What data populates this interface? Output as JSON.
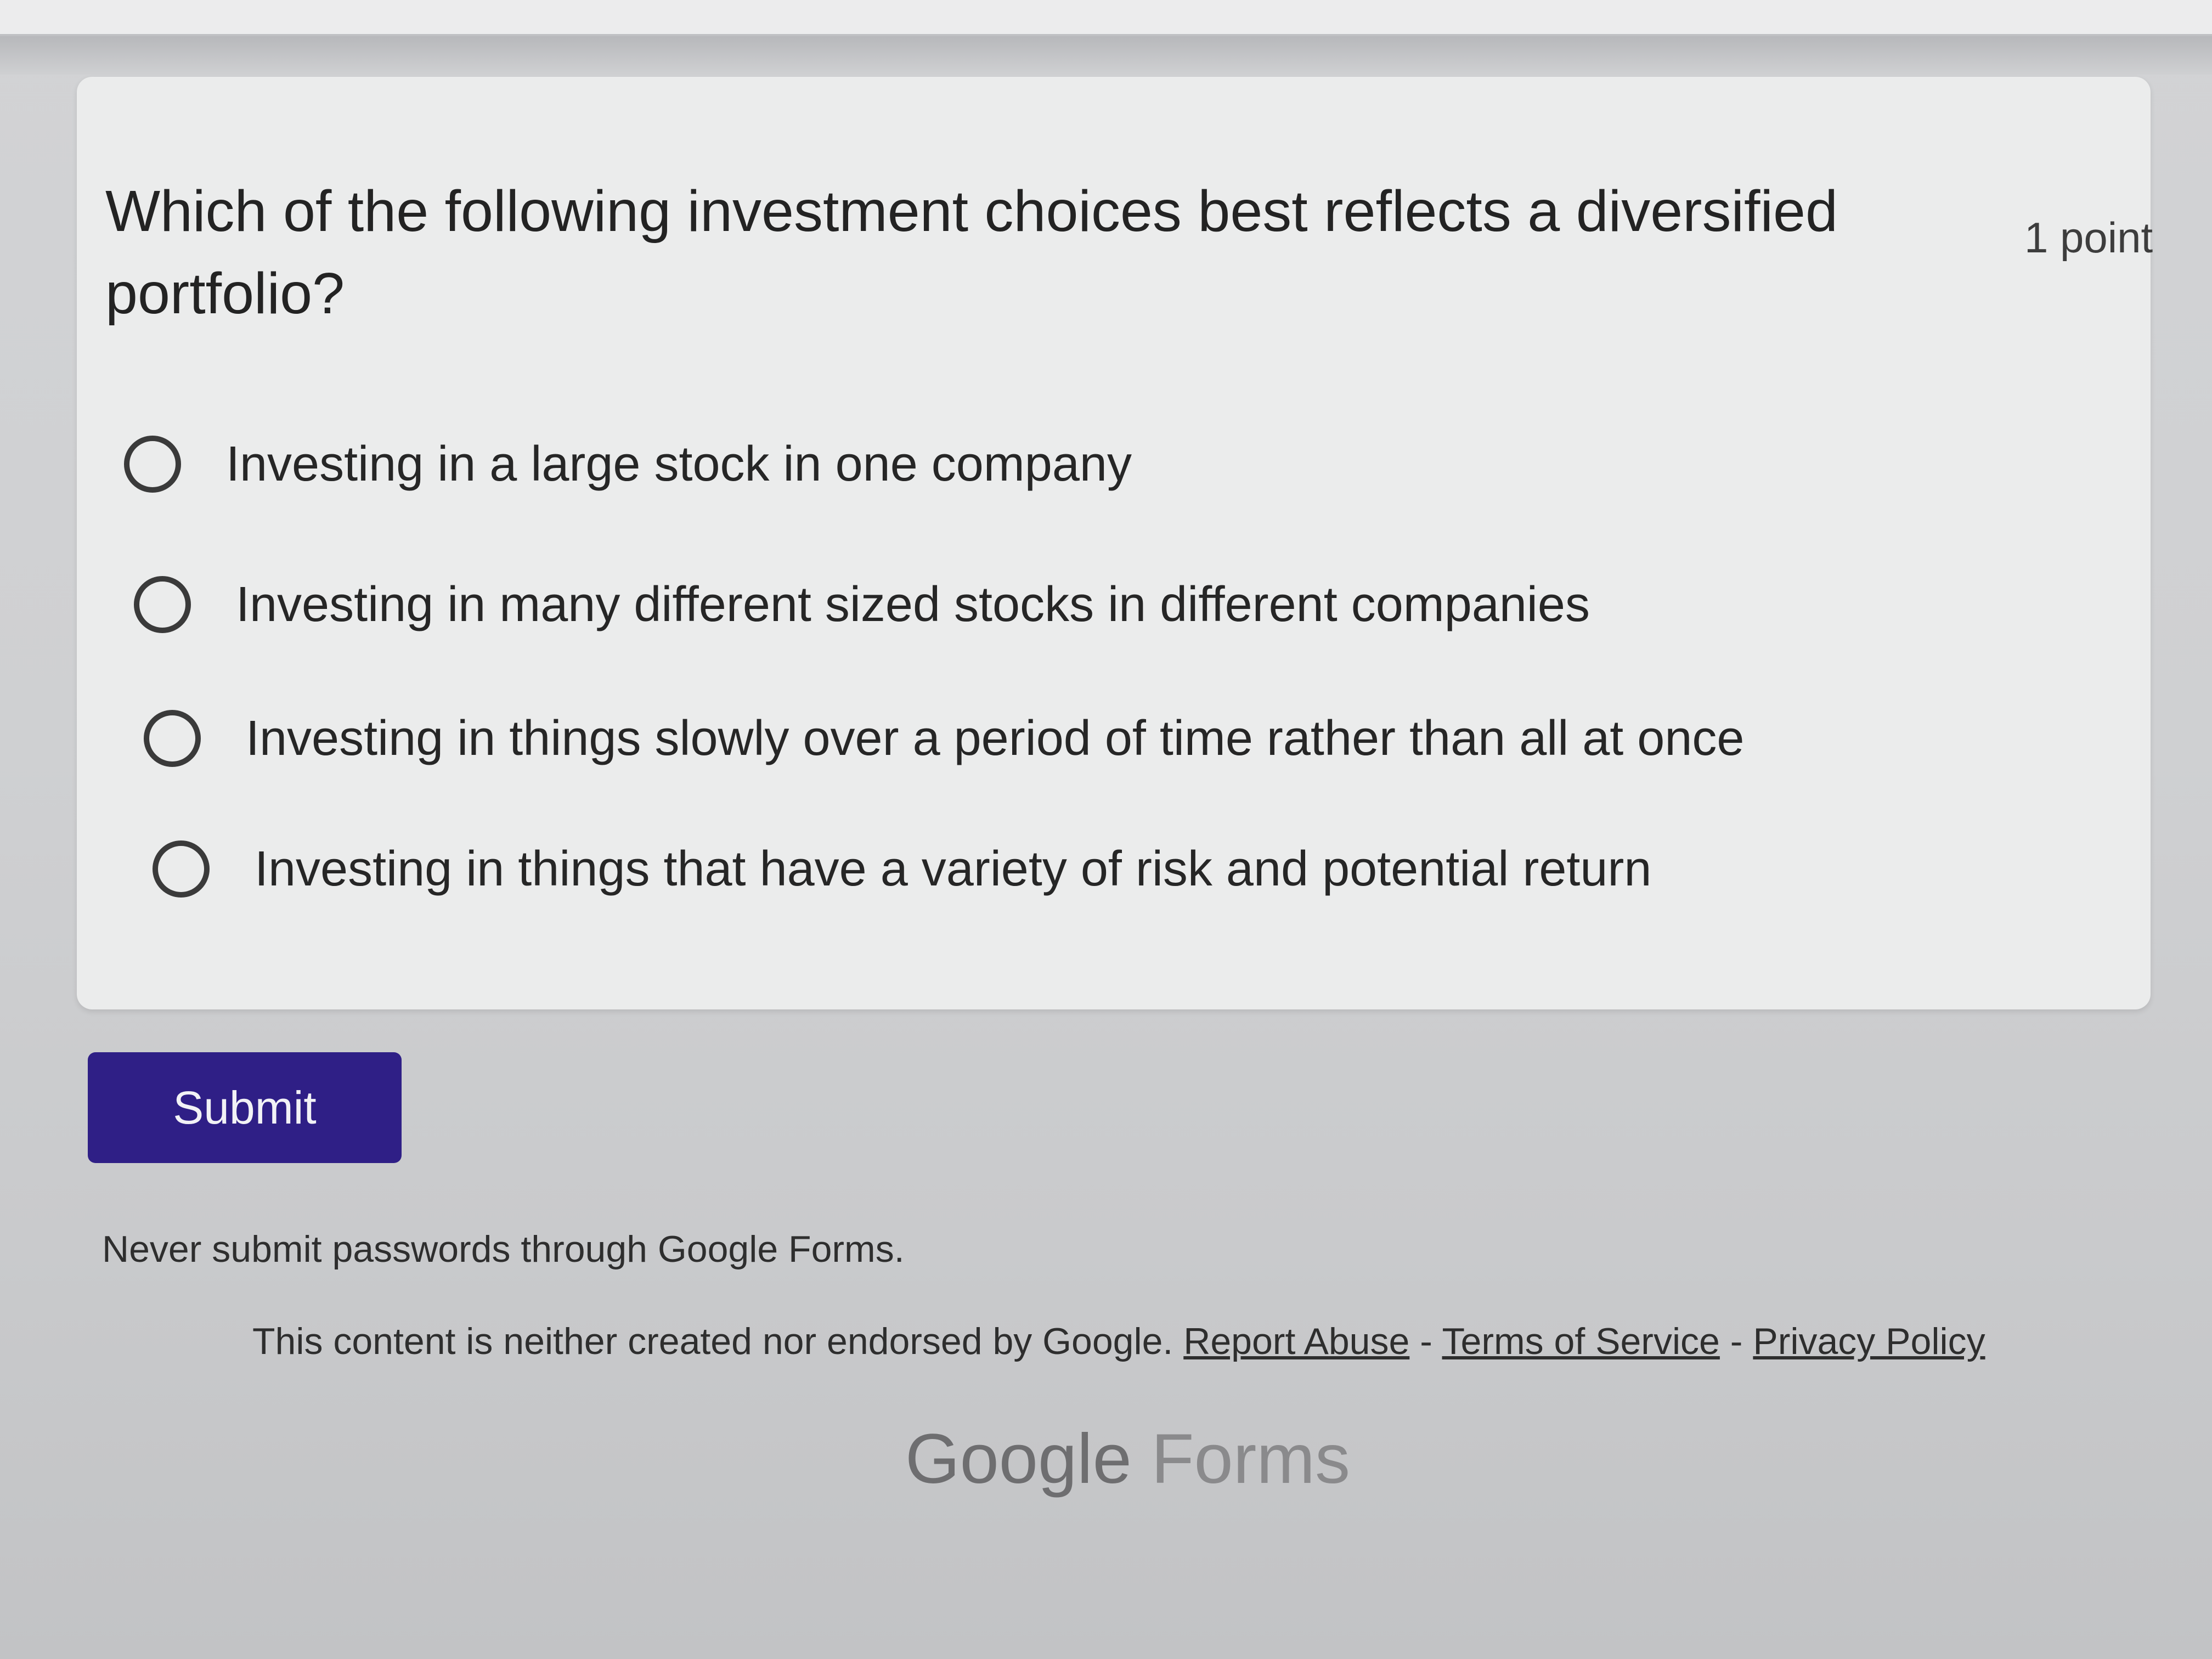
{
  "question": {
    "line1": "Which of the following investment choices best reflects a diversified",
    "line2": "portfolio?",
    "points": "1 point"
  },
  "options": [
    {
      "label": "Investing in a large stock in one company",
      "selected": false
    },
    {
      "label": "Investing in many different sized stocks in different companies",
      "selected": false
    },
    {
      "label": "Investing in things slowly over a period of time rather than all at once",
      "selected": false
    },
    {
      "label": "Investing in things that have a variety of risk and potential return",
      "selected": false
    }
  ],
  "submit_label": "Submit",
  "footer": {
    "warning": "Never submit passwords through Google Forms.",
    "disclaimer": "This content is neither created nor endorsed by Google.",
    "report_abuse": "Report Abuse",
    "terms": "Terms of Service",
    "privacy": "Privacy Policy",
    "separator": "-"
  },
  "logo": {
    "google": "Google",
    "forms": "Forms"
  },
  "colors": {
    "submit_bg": "#2f1f86",
    "card_bg": "#ebecec",
    "page_bg": "#cfd0d2"
  }
}
